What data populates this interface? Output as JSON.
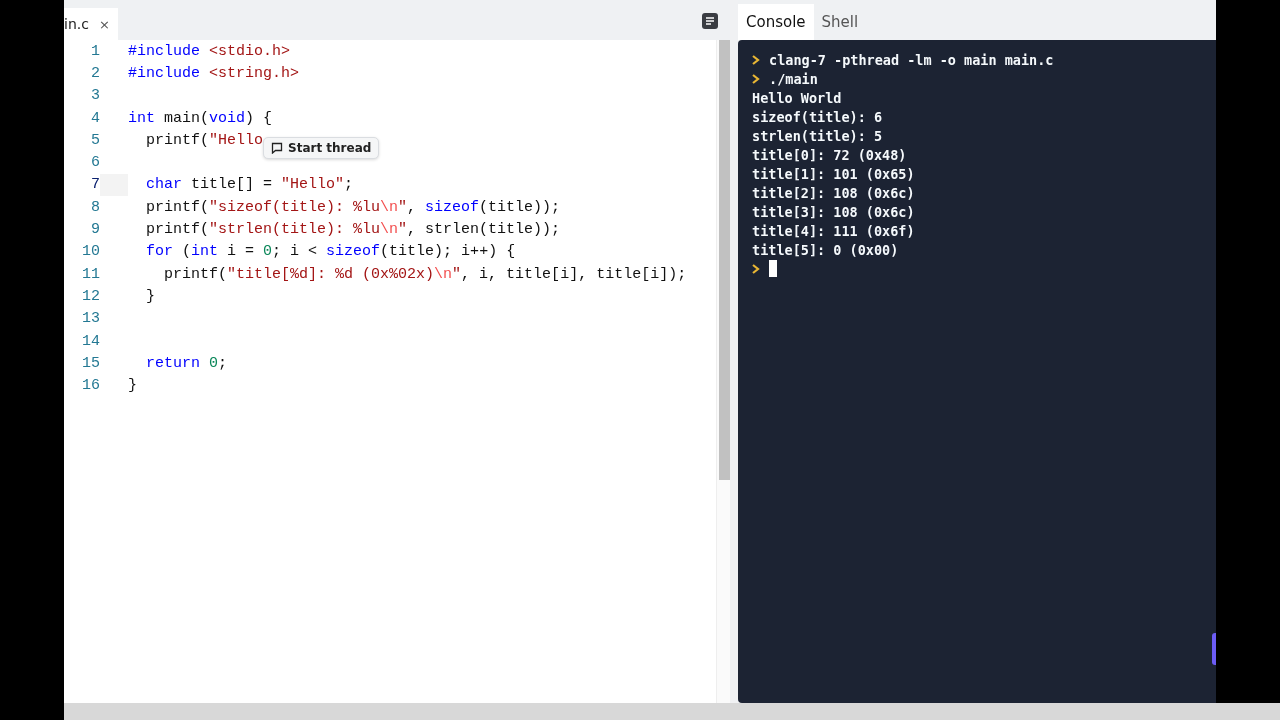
{
  "editor": {
    "tabs": [
      {
        "label": "in.c",
        "close": "×",
        "selected": true
      }
    ],
    "lines": [
      {
        "number": "1",
        "current": false,
        "tokens": [
          {
            "kind": "keyword",
            "text": "#include "
          },
          {
            "kind": "string",
            "text": "<stdio.h>"
          }
        ]
      },
      {
        "number": "2",
        "current": false,
        "tokens": [
          {
            "kind": "keyword",
            "text": "#include "
          },
          {
            "kind": "string",
            "text": "<string.h>"
          }
        ]
      },
      {
        "number": "3",
        "current": false
      },
      {
        "number": "4",
        "current": false,
        "tokens": [
          {
            "kind": "keyword",
            "text": "int"
          },
          {
            "kind": "plain",
            "text": " main("
          },
          {
            "kind": "keyword",
            "text": "void"
          },
          {
            "kind": "plain",
            "text": ") {"
          }
        ]
      },
      {
        "number": "5",
        "current": false,
        "tokens": [
          {
            "kind": "plain",
            "text": "  printf("
          },
          {
            "kind": "string",
            "text": "\"Hello"
          }
        ]
      },
      {
        "number": "6",
        "current": false
      },
      {
        "number": "7",
        "current": true,
        "tokens": [
          {
            "kind": "keyword",
            "text": "  char"
          },
          {
            "kind": "plain",
            "text": " title[] = "
          },
          {
            "kind": "string",
            "text": "\"Hello\""
          },
          {
            "kind": "plain",
            "text": ";"
          }
        ]
      },
      {
        "number": "8",
        "current": false,
        "tokens": [
          {
            "kind": "plain",
            "text": "  printf("
          },
          {
            "kind": "string",
            "text": "\"sizeof(title): %lu"
          },
          {
            "kind": "escape",
            "text": "\\n"
          },
          {
            "kind": "string",
            "text": "\""
          },
          {
            "kind": "plain",
            "text": ", "
          },
          {
            "kind": "keyword",
            "text": "sizeof"
          },
          {
            "kind": "plain",
            "text": "(title));"
          }
        ]
      },
      {
        "number": "9",
        "current": false,
        "tokens": [
          {
            "kind": "plain",
            "text": "  printf("
          },
          {
            "kind": "string",
            "text": "\"strlen(title): %lu"
          },
          {
            "kind": "escape",
            "text": "\\n"
          },
          {
            "kind": "string",
            "text": "\""
          },
          {
            "kind": "plain",
            "text": ", strlen(title));"
          }
        ]
      },
      {
        "number": "10",
        "current": false,
        "tokens": [
          {
            "kind": "keyword",
            "text": "  for"
          },
          {
            "kind": "plain",
            "text": " ("
          },
          {
            "kind": "keyword",
            "text": "int"
          },
          {
            "kind": "plain",
            "text": " i = "
          },
          {
            "kind": "number",
            "text": "0"
          },
          {
            "kind": "plain",
            "text": "; i < "
          },
          {
            "kind": "keyword",
            "text": "sizeof"
          },
          {
            "kind": "plain",
            "text": "(title); i++) {"
          }
        ]
      },
      {
        "number": "11",
        "current": false,
        "tokens": [
          {
            "kind": "plain",
            "text": "    printf("
          },
          {
            "kind": "string",
            "text": "\"title[%d]: %d (0x%02x)"
          },
          {
            "kind": "escape",
            "text": "\\n"
          },
          {
            "kind": "string",
            "text": "\""
          },
          {
            "kind": "plain",
            "text": ", i, title[i], title[i]);"
          }
        ]
      },
      {
        "number": "12",
        "current": false,
        "tokens": [
          {
            "kind": "plain",
            "text": "  }"
          }
        ]
      },
      {
        "number": "13",
        "current": false
      },
      {
        "number": "14",
        "current": false
      },
      {
        "number": "15",
        "current": false,
        "tokens": [
          {
            "kind": "keyword",
            "text": "  return"
          },
          {
            "kind": "number",
            "text": " 0"
          },
          {
            "kind": "plain",
            "text": ";"
          }
        ]
      },
      {
        "number": "16",
        "current": false,
        "tokens": [
          {
            "kind": "plain",
            "text": "}"
          }
        ]
      }
    ],
    "tooltip": {
      "label": "Start thread"
    }
  },
  "console": {
    "tabs": [
      {
        "label": "Console",
        "selected": true
      },
      {
        "label": "Shell",
        "selected": false
      }
    ],
    "lines": [
      {
        "kind": "command",
        "text": "clang-7 -pthread -lm -o main main.c"
      },
      {
        "kind": "command",
        "text": "./main"
      },
      {
        "kind": "output",
        "text": "Hello World"
      },
      {
        "kind": "output",
        "text": "sizeof(title): 6"
      },
      {
        "kind": "output",
        "text": "strlen(title): 5"
      },
      {
        "kind": "output",
        "text": "title[0]: 72 (0x48)"
      },
      {
        "kind": "output",
        "text": "title[1]: 101 (0x65)"
      },
      {
        "kind": "output",
        "text": "title[2]: 108 (0x6c)"
      },
      {
        "kind": "output",
        "text": "title[3]: 108 (0x6c)"
      },
      {
        "kind": "output",
        "text": "title[4]: 111 (0x6f)"
      },
      {
        "kind": "output",
        "text": "title[5]: 0 (0x00)"
      },
      {
        "kind": "prompt"
      }
    ]
  }
}
